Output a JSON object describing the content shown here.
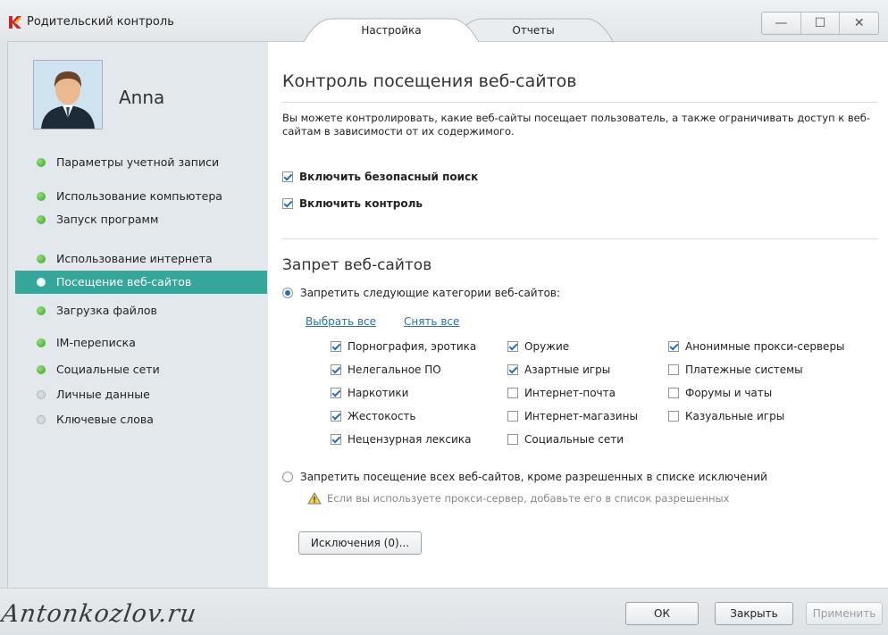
{
  "window": {
    "title": "Родительский контроль",
    "tabs": [
      {
        "label": "Настройка",
        "active": true
      },
      {
        "label": "Отчеты",
        "active": false
      }
    ],
    "controls": {
      "minimize": "—",
      "maximize": "☐",
      "close": "✕"
    }
  },
  "sidebar": {
    "user_name": "Anna",
    "items": [
      {
        "label": "Параметры учетной записи",
        "status": "green"
      },
      {
        "label": "Использование компьютера",
        "status": "green"
      },
      {
        "label": "Запуск программ",
        "status": "green"
      },
      {
        "label": "Использование интернета",
        "status": "green"
      },
      {
        "label": "Посещение веб-сайтов",
        "status": "green",
        "active": true
      },
      {
        "label": "Загрузка файлов",
        "status": "green"
      },
      {
        "label": "IM-переписка",
        "status": "green"
      },
      {
        "label": "Социальные сети",
        "status": "green"
      },
      {
        "label": "Личные данные",
        "status": "gray"
      },
      {
        "label": "Ключевые слова",
        "status": "gray"
      }
    ]
  },
  "main": {
    "title": "Контроль посещения веб-сайтов",
    "description": "Вы можете контролировать, какие веб-сайты посещает пользователь, а также ограничивать доступ к веб-сайтам в зависимости от их содержимого.",
    "safe_search": {
      "label": "Включить безопасный поиск",
      "checked": true
    },
    "enable_control": {
      "label": "Включить контроль",
      "checked": true
    },
    "block_section_title": "Запрет веб-сайтов",
    "radio_block_categories": {
      "label": "Запретить следующие категории веб-сайтов:",
      "selected": true
    },
    "select_all": "Выбрать все",
    "clear_all": "Снять все",
    "categories": [
      [
        {
          "label": "Порнография, эротика",
          "checked": true
        },
        {
          "label": "Нелегальное ПО",
          "checked": true
        },
        {
          "label": "Наркотики",
          "checked": true
        },
        {
          "label": "Жестокость",
          "checked": true
        },
        {
          "label": "Нецензурная лексика",
          "checked": true
        }
      ],
      [
        {
          "label": "Оружие",
          "checked": true
        },
        {
          "label": "Азартные игры",
          "checked": true
        },
        {
          "label": "Интернет-почта",
          "checked": false
        },
        {
          "label": "Интернет-магазины",
          "checked": false
        },
        {
          "label": "Социальные сети",
          "checked": false
        }
      ],
      [
        {
          "label": "Анонимные прокси-серверы",
          "checked": true
        },
        {
          "label": "Платежные системы",
          "checked": false
        },
        {
          "label": "Форумы и чаты",
          "checked": false
        },
        {
          "label": "Казуальные игры",
          "checked": false
        }
      ]
    ],
    "radio_block_all": {
      "label": "Запретить посещение всех веб-сайтов, кроме разрешенных в списке исключений",
      "selected": false
    },
    "proxy_warning": "Если вы используете прокси-сервер, добавьте его в список разрешенных",
    "exceptions_button": "Исключения (0)..."
  },
  "footer": {
    "watermark": "Antonkozlov.ru",
    "ok": "ОК",
    "close": "Закрыть",
    "apply": "Применить"
  },
  "colors": {
    "accent_active": "#34a69a",
    "status_green": "#3aa22a",
    "link": "#2a6fb3"
  }
}
